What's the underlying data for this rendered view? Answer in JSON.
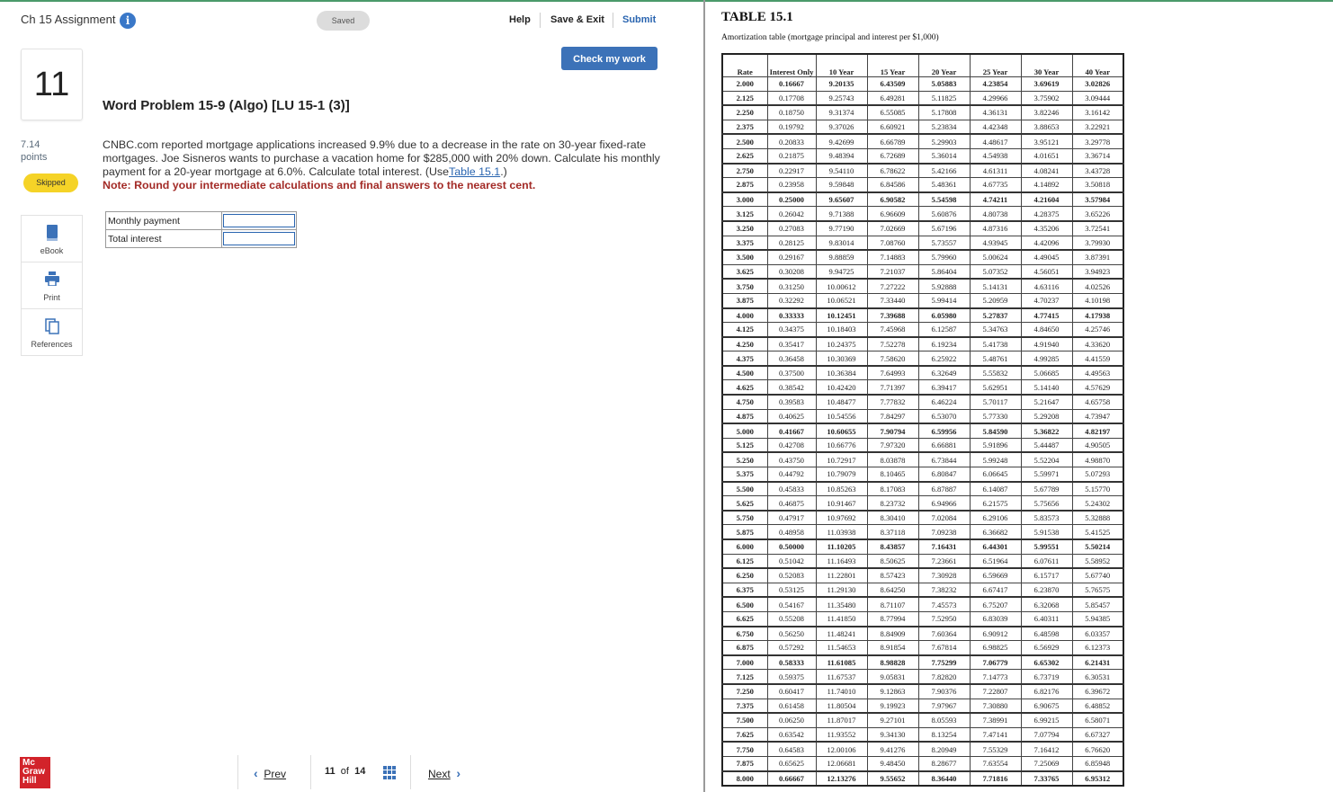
{
  "header": {
    "assignment_title": "Ch 15 Assignment",
    "info_icon_glyph": "i",
    "saved_label": "Saved",
    "help_label": "Help",
    "save_exit_label": "Save & Exit",
    "submit_label": "Submit"
  },
  "question": {
    "number": "11",
    "points_value": "7.14",
    "points_label": "points",
    "status_badge": "Skipped",
    "check_button_label": "Check my work",
    "title": "Word Problem 15-9 (Algo) [LU 15-1 (3)]",
    "body": "CNBC.com reported mortgage applications increased 9.9% due to a decrease in the rate on 30-year fixed-rate mortgages. Joe Sisneros wants to purchase a vacation home for $285,000 with 20% down. Calculate his monthly payment for a 20-year mortgage at 6.0%. Calculate total interest. (Use",
    "body_link": "Table 15.1",
    "body_end": ".)",
    "note": "Note: Round your intermediate calculations and final answers to the nearest cent.",
    "answer_rows": [
      {
        "label": "Monthly payment",
        "value": ""
      },
      {
        "label": "Total interest",
        "value": ""
      }
    ]
  },
  "tools": [
    {
      "label": "eBook",
      "icon": "book-icon"
    },
    {
      "label": "Print",
      "icon": "printer-icon"
    },
    {
      "label": "References",
      "icon": "references-icon"
    }
  ],
  "footer": {
    "logo_text": [
      "Mc",
      "Graw",
      "Hill"
    ],
    "prev_label": "Prev",
    "next_label": "Next",
    "current": "11",
    "of_label": "of",
    "total": "14"
  },
  "colors": {
    "accent_blue": "#3c72b8",
    "skipped_yellow": "#f5d327",
    "note_red": "#a32b27",
    "logo_red": "#d2232a"
  },
  "table": {
    "title": "TABLE 15.1",
    "caption": "Amortization table (mortgage principal and interest per $1,000)",
    "headers": [
      "Rate",
      "Interest Only",
      "10 Year",
      "15 Year",
      "20 Year",
      "25 Year",
      "30 Year",
      "40 Year"
    ],
    "rows": [
      [
        "2.000",
        "0.16667",
        "9.20135",
        "6.43509",
        "5.05883",
        "4.23854",
        "3.69619",
        "3.02826"
      ],
      [
        "2.125",
        "0.17708",
        "9.25743",
        "6.49281",
        "5.11825",
        "4.29966",
        "3.75902",
        "3.09444"
      ],
      [
        "2.250",
        "0.18750",
        "9.31374",
        "6.55085",
        "5.17808",
        "4.36131",
        "3.82246",
        "3.16142"
      ],
      [
        "2.375",
        "0.19792",
        "9.37026",
        "6.60921",
        "5.23834",
        "4.42348",
        "3.88653",
        "3.22921"
      ],
      [
        "2.500",
        "0.20833",
        "9.42699",
        "6.66789",
        "5.29903",
        "4.48617",
        "3.95121",
        "3.29778"
      ],
      [
        "2.625",
        "0.21875",
        "9.48394",
        "6.72689",
        "5.36014",
        "4.54938",
        "4.01651",
        "3.36714"
      ],
      [
        "2.750",
        "0.22917",
        "9.54110",
        "6.78622",
        "5.42166",
        "4.61311",
        "4.08241",
        "3.43728"
      ],
      [
        "2.875",
        "0.23958",
        "9.59848",
        "6.84586",
        "5.48361",
        "4.67735",
        "4.14892",
        "3.50818"
      ],
      [
        "3.000",
        "0.25000",
        "9.65607",
        "6.90582",
        "5.54598",
        "4.74211",
        "4.21604",
        "3.57984"
      ],
      [
        "3.125",
        "0.26042",
        "9.71388",
        "6.96609",
        "5.60876",
        "4.80738",
        "4.28375",
        "3.65226"
      ],
      [
        "3.250",
        "0.27083",
        "9.77190",
        "7.02669",
        "5.67196",
        "4.87316",
        "4.35206",
        "3.72541"
      ],
      [
        "3.375",
        "0.28125",
        "9.83014",
        "7.08760",
        "5.73557",
        "4.93945",
        "4.42096",
        "3.79930"
      ],
      [
        "3.500",
        "0.29167",
        "9.88859",
        "7.14883",
        "5.79960",
        "5.00624",
        "4.49045",
        "3.87391"
      ],
      [
        "3.625",
        "0.30208",
        "9.94725",
        "7.21037",
        "5.86404",
        "5.07352",
        "4.56051",
        "3.94923"
      ],
      [
        "3.750",
        "0.31250",
        "10.00612",
        "7.27222",
        "5.92888",
        "5.14131",
        "4.63116",
        "4.02526"
      ],
      [
        "3.875",
        "0.32292",
        "10.06521",
        "7.33440",
        "5.99414",
        "5.20959",
        "4.70237",
        "4.10198"
      ],
      [
        "4.000",
        "0.33333",
        "10.12451",
        "7.39688",
        "6.05980",
        "5.27837",
        "4.77415",
        "4.17938"
      ],
      [
        "4.125",
        "0.34375",
        "10.18403",
        "7.45968",
        "6.12587",
        "5.34763",
        "4.84650",
        "4.25746"
      ],
      [
        "4.250",
        "0.35417",
        "10.24375",
        "7.52278",
        "6.19234",
        "5.41738",
        "4.91940",
        "4.33620"
      ],
      [
        "4.375",
        "0.36458",
        "10.30369",
        "7.58620",
        "6.25922",
        "5.48761",
        "4.99285",
        "4.41559"
      ],
      [
        "4.500",
        "0.37500",
        "10.36384",
        "7.64993",
        "6.32649",
        "5.55832",
        "5.06685",
        "4.49563"
      ],
      [
        "4.625",
        "0.38542",
        "10.42420",
        "7.71397",
        "6.39417",
        "5.62951",
        "5.14140",
        "4.57629"
      ],
      [
        "4.750",
        "0.39583",
        "10.48477",
        "7.77832",
        "6.46224",
        "5.70117",
        "5.21647",
        "4.65758"
      ],
      [
        "4.875",
        "0.40625",
        "10.54556",
        "7.84297",
        "6.53070",
        "5.77330",
        "5.29208",
        "4.73947"
      ],
      [
        "5.000",
        "0.41667",
        "10.60655",
        "7.90794",
        "6.59956",
        "5.84590",
        "5.36822",
        "4.82197"
      ],
      [
        "5.125",
        "0.42708",
        "10.66776",
        "7.97320",
        "6.66881",
        "5.91896",
        "5.44487",
        "4.90505"
      ],
      [
        "5.250",
        "0.43750",
        "10.72917",
        "8.03878",
        "6.73844",
        "5.99248",
        "5.52204",
        "4.98870"
      ],
      [
        "5.375",
        "0.44792",
        "10.79079",
        "8.10465",
        "6.80847",
        "6.06645",
        "5.59971",
        "5.07293"
      ],
      [
        "5.500",
        "0.45833",
        "10.85263",
        "8.17083",
        "6.87887",
        "6.14087",
        "5.67789",
        "5.15770"
      ],
      [
        "5.625",
        "0.46875",
        "10.91467",
        "8.23732",
        "6.94966",
        "6.21575",
        "5.75656",
        "5.24302"
      ],
      [
        "5.750",
        "0.47917",
        "10.97692",
        "8.30410",
        "7.02084",
        "6.29106",
        "5.83573",
        "5.32888"
      ],
      [
        "5.875",
        "0.48958",
        "11.03938",
        "8.37118",
        "7.09238",
        "6.36682",
        "5.91538",
        "5.41525"
      ],
      [
        "6.000",
        "0.50000",
        "11.10205",
        "8.43857",
        "7.16431",
        "6.44301",
        "5.99551",
        "5.50214"
      ],
      [
        "6.125",
        "0.51042",
        "11.16493",
        "8.50625",
        "7.23661",
        "6.51964",
        "6.07611",
        "5.58952"
      ],
      [
        "6.250",
        "0.52083",
        "11.22801",
        "8.57423",
        "7.30928",
        "6.59669",
        "6.15717",
        "5.67740"
      ],
      [
        "6.375",
        "0.53125",
        "11.29130",
        "8.64250",
        "7.38232",
        "6.67417",
        "6.23870",
        "5.76575"
      ],
      [
        "6.500",
        "0.54167",
        "11.35480",
        "8.71107",
        "7.45573",
        "6.75207",
        "6.32068",
        "5.85457"
      ],
      [
        "6.625",
        "0.55208",
        "11.41850",
        "8.77994",
        "7.52950",
        "6.83039",
        "6.40311",
        "5.94385"
      ],
      [
        "6.750",
        "0.56250",
        "11.48241",
        "8.84909",
        "7.60364",
        "6.90912",
        "6.48598",
        "6.03357"
      ],
      [
        "6.875",
        "0.57292",
        "11.54653",
        "8.91854",
        "7.67814",
        "6.98825",
        "6.56929",
        "6.12373"
      ],
      [
        "7.000",
        "0.58333",
        "11.61085",
        "8.98828",
        "7.75299",
        "7.06779",
        "6.65302",
        "6.21431"
      ],
      [
        "7.125",
        "0.59375",
        "11.67537",
        "9.05831",
        "7.82820",
        "7.14773",
        "6.73719",
        "6.30531"
      ],
      [
        "7.250",
        "0.60417",
        "11.74010",
        "9.12863",
        "7.90376",
        "7.22807",
        "6.82176",
        "6.39672"
      ],
      [
        "7.375",
        "0.61458",
        "11.80504",
        "9.19923",
        "7.97967",
        "7.30880",
        "6.90675",
        "6.48852"
      ],
      [
        "7.500",
        "0.06250",
        "11.87017",
        "9.27101",
        "8.05593",
        "7.38991",
        "6.99215",
        "6.58071"
      ],
      [
        "7.625",
        "0.63542",
        "11.93552",
        "9.34130",
        "8.13254",
        "7.47141",
        "7.07794",
        "6.67327"
      ],
      [
        "7.750",
        "0.64583",
        "12.00106",
        "9.41276",
        "8.20949",
        "7.55329",
        "7.16412",
        "6.76620"
      ],
      [
        "7.875",
        "0.65625",
        "12.06681",
        "9.48450",
        "8.28677",
        "7.63554",
        "7.25069",
        "6.85948"
      ],
      [
        "8.000",
        "0.66667",
        "12.13276",
        "9.55652",
        "8.36440",
        "7.71816",
        "7.33765",
        "6.95312"
      ]
    ],
    "bold_rates": [
      "2.000",
      "3.000",
      "4.000",
      "5.000",
      "6.000",
      "7.000",
      "8.000"
    ]
  }
}
